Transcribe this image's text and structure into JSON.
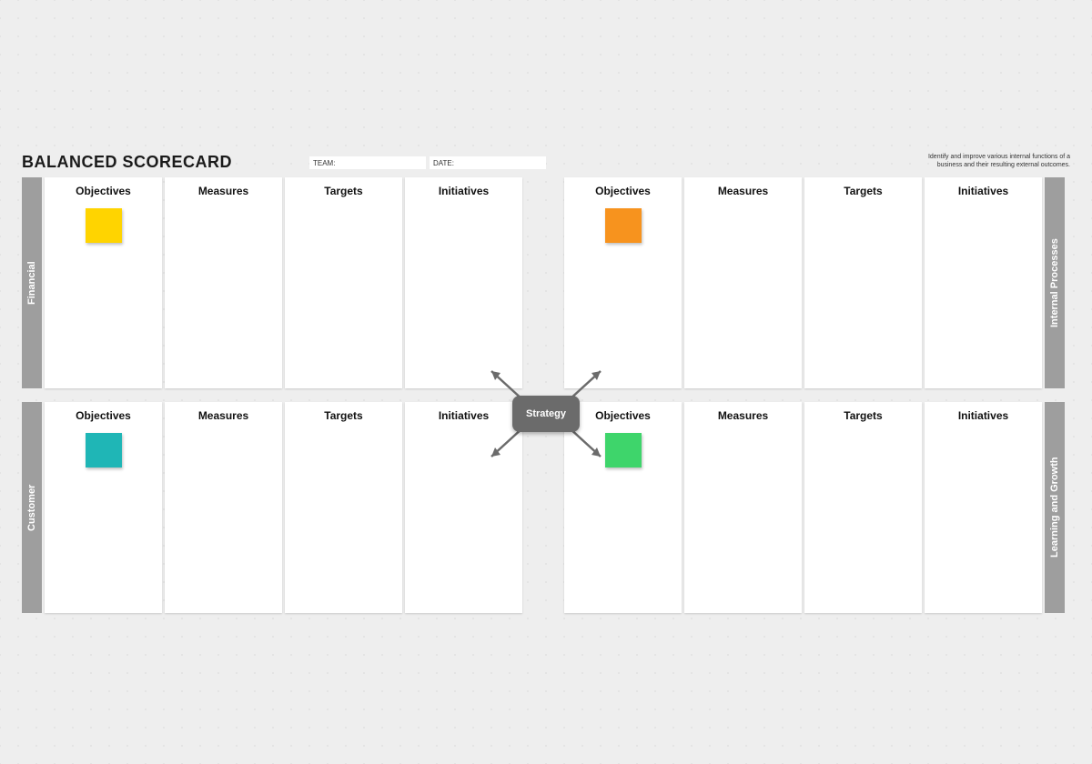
{
  "title": "BALANCED SCORECARD",
  "description": "Identify and improve various internal functions of a business and their resulting external outcomes.",
  "fields": {
    "team_label": "TEAM:",
    "date_label": "DATE:"
  },
  "columns": {
    "c0": "Objectives",
    "c1": "Measures",
    "c2": "Targets",
    "c3": "Initiatives"
  },
  "center": "Strategy",
  "quadrants": {
    "tl": {
      "label": "Financial",
      "sticky_color": "#ffd400"
    },
    "tr": {
      "label": "Internal Processes",
      "sticky_color": "#f7931e"
    },
    "bl": {
      "label": "Customer",
      "sticky_color": "#1fb6b6"
    },
    "br": {
      "label": "Learning and Growth",
      "sticky_color": "#3ed56b"
    }
  }
}
